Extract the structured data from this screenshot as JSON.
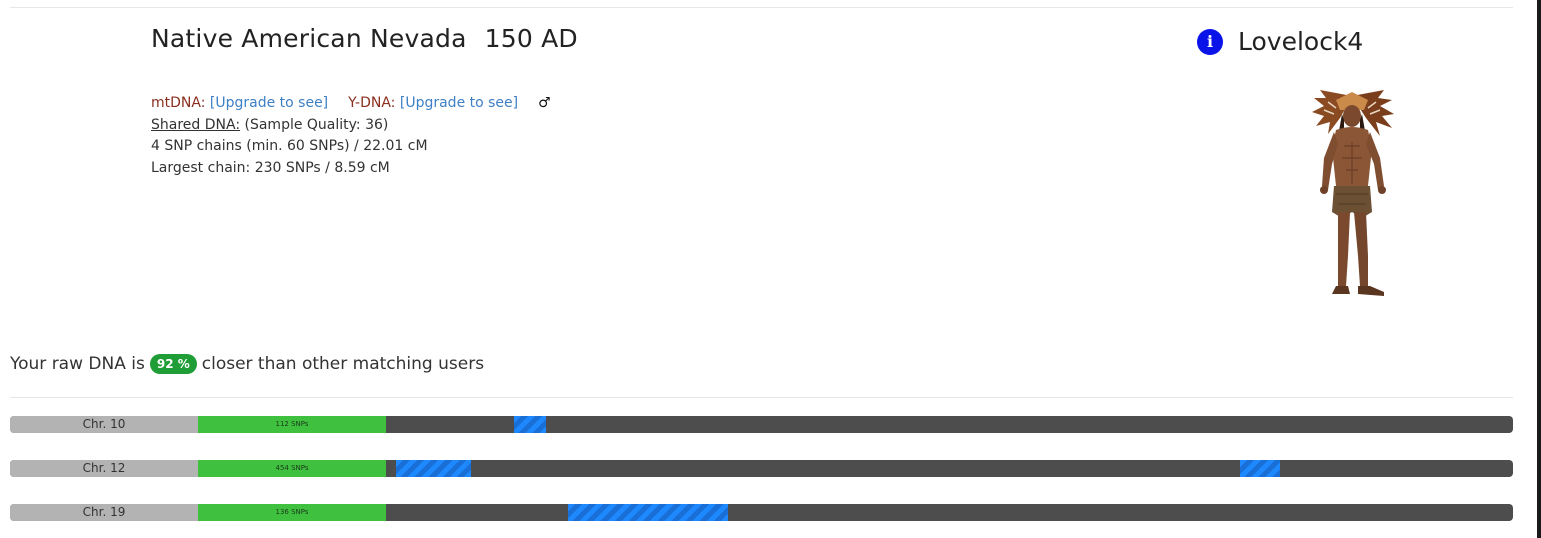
{
  "header": {
    "title": "Native American Nevada",
    "date": "150 AD",
    "sample_name": "Lovelock4",
    "info_icon": "info-icon",
    "info_glyph": "i"
  },
  "meta": {
    "mtdna_label": "mtDNA:",
    "mtdna_link": "[Upgrade to see]",
    "ydna_label": "Y-DNA:",
    "ydna_link": "[Upgrade to see]",
    "sex_symbol": "♂",
    "shared_label": "Shared DNA:",
    "sample_quality": "(Sample Quality: 36)",
    "snp_chains": "4 SNP chains (min. 60 SNPs) / 22.01 cM",
    "largest_chain": "Largest chain: 230 SNPs / 8.59 cM"
  },
  "closer": {
    "prefix": "Your raw DNA is",
    "percent": "92 %",
    "suffix": "closer than other matching users"
  },
  "chromosomes": [
    {
      "label": "Chr. 10",
      "snps": "112 SNPs",
      "segments": [
        {
          "start": 0.3355,
          "end": 0.3568
        }
      ]
    },
    {
      "label": "Chr. 12",
      "snps": "454 SNPs",
      "segments": [
        {
          "start": 0.2571,
          "end": 0.3068
        },
        {
          "start": 0.8181,
          "end": 0.8447
        }
      ]
    },
    {
      "label": "Chr. 19",
      "snps": "136 SNPs",
      "segments": [
        {
          "start": 0.371,
          "end": 0.4774
        }
      ]
    }
  ],
  "colors": {
    "info_icon": "#0a14e8",
    "badge": "#1f9d36",
    "snp_bar": "#3fc13f",
    "segment": "#1e88ff",
    "track": "#4d4d4d",
    "label_bg": "#b3b3b3"
  },
  "image": {
    "alt": "Native American warrior figure with feather headdress",
    "icon": "warrior-figure"
  }
}
